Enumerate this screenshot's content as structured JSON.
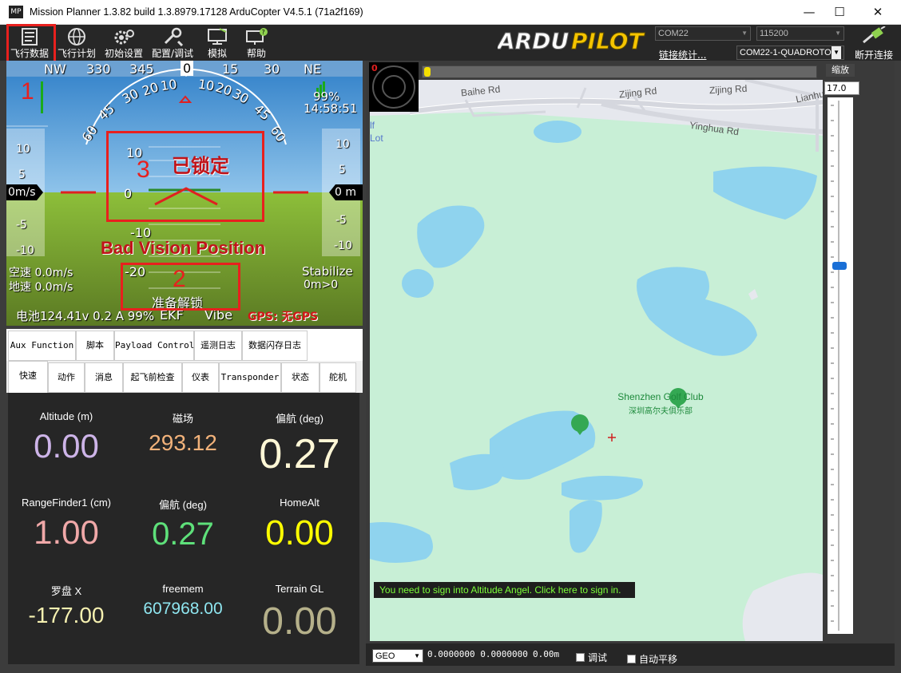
{
  "window": {
    "title": "Mission Planner 1.3.82 build 1.3.8979.17128 ArduCopter V4.5.1 (71a2f169)",
    "icon_text": "MP",
    "minimize": "—",
    "maximize": "☐",
    "close": "✕"
  },
  "toolbar": {
    "items": [
      {
        "label": "飞行数据",
        "icon": "flight-data-icon"
      },
      {
        "label": "飞行计划",
        "icon": "globe-icon"
      },
      {
        "label": "初始设置",
        "icon": "gears-icon"
      },
      {
        "label": "配置/调试",
        "icon": "wrench-icon"
      },
      {
        "label": "模拟",
        "icon": "monitor-plane-icon"
      },
      {
        "label": "帮助",
        "icon": "monitor-help-icon"
      }
    ],
    "logo_text": "ARDUPILOT",
    "port": "COM22",
    "baud": "115200",
    "link_stats": "链接统计...",
    "vehicle": "COM22-1-QUADROTOR",
    "disconnect": "断开连接"
  },
  "hud": {
    "heading_ticks": [
      "NW",
      "330",
      "345",
      "0",
      "15",
      "30",
      "NE"
    ],
    "heading_value": "0",
    "roll_ticks": [
      "60",
      "45",
      "30",
      "20",
      "10",
      "0",
      "10",
      "20",
      "30",
      "45",
      "60"
    ],
    "battery_pct": "99%",
    "time": "14:58:51",
    "speed_ticks": [
      "10",
      "5",
      "0m/s",
      "-5",
      "-10"
    ],
    "alt_ticks": [
      "10",
      "5",
      "0 m",
      "-5",
      "-10"
    ],
    "speed_value": "0m/s",
    "alt_value": "0 m",
    "pitch_ticks": [
      "10",
      "0",
      "-10",
      "-20"
    ],
    "locked_text": "已锁定",
    "bad_vision": "Bad Vision Position",
    "airspeed": "空速 0.0m/s",
    "groundspeed": "地速 0.0m/s",
    "mode": "Stabilize",
    "wp_dist": "0m>0",
    "arm_text": "准备解锁",
    "battery_line": "电池124.41v 0.2 A 99%",
    "ekf": "EKF",
    "vibe": "Vibe",
    "gps": "GPS: 无GPS",
    "annot_1": "1",
    "annot_2": "2",
    "annot_3": "3"
  },
  "tabs_row1": [
    "Aux Function",
    "脚本",
    "Payload Control",
    "遥测日志",
    "数据闪存日志"
  ],
  "tabs_row2": [
    "快速",
    "动作",
    "消息",
    "起飞前检查",
    "仪表",
    "Transponder",
    "状态",
    "舵机"
  ],
  "quick": [
    {
      "label": "Altitude (m)",
      "value": "0.00",
      "color": "#cdb4e8"
    },
    {
      "label": "磁场",
      "value": "293.12",
      "color": "#f2b27a"
    },
    {
      "label": "偏航 (deg)",
      "value": "0.27",
      "color": "#fff7d6"
    },
    {
      "label": "RangeFinder1 (cm)",
      "value": "1.00",
      "color": "#f0a8a8"
    },
    {
      "label": "偏航 (deg)",
      "value": "0.27",
      "color": "#5ee07a"
    },
    {
      "label": "HomeAlt",
      "value": "0.00",
      "color": "#ffff00"
    },
    {
      "label": "罗盘 X",
      "value": "-177.00",
      "color": "#f5f0b0"
    },
    {
      "label": "freemem",
      "value": "607968.00",
      "color": "#8fe6f0"
    },
    {
      "label": "Terrain GL",
      "value": "0.00",
      "color": "#b5b08a"
    }
  ],
  "map": {
    "compass_label": "0",
    "roads": [
      "Baihe Rd",
      "Zijing Rd",
      "Zijing Rd",
      "Lianhu",
      "Yinghua Rd"
    ],
    "edge_text": [
      "lf",
      "Lot"
    ],
    "poi_name": "Shenzhen Golf Club",
    "poi_name_cn": "深圳高尔夫俱乐部",
    "altitude_angel": "You need to sign into Altitude Angel. Click here to sign in.",
    "zoom_label": "缩放",
    "zoom_value": "17.0",
    "zoom_level": 0.31
  },
  "statusbar": {
    "coord_type": "GEO",
    "coords": "0.0000000 0.0000000",
    "alt": "0.00m",
    "debug_label": "调试",
    "autopan_label": "自动平移"
  }
}
